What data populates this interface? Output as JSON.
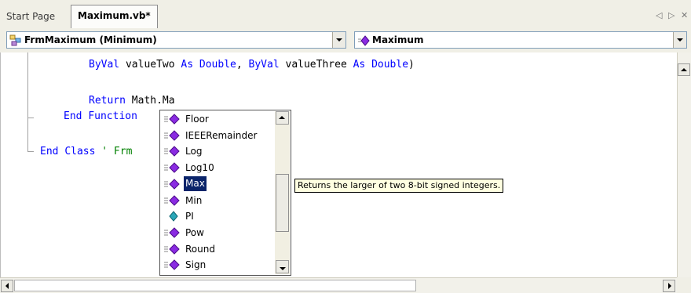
{
  "tabs": {
    "start_label": "Start Page",
    "active_label": "Maximum.vb*",
    "nav_prev": "◁",
    "nav_next": "▷",
    "close": "✕"
  },
  "combos": {
    "class_value": "FrmMaximum (Minimum)",
    "method_value": "Maximum",
    "class_icon": "class-icon",
    "method_icon": "method-icon"
  },
  "code": {
    "line1_indent": "        ",
    "line1_kw1": "ByVal",
    "line1_t1": " valueTwo ",
    "line1_kw2": "As",
    "line1_kw3": "Double",
    "line1_t2": ", ",
    "line1_kw4": "ByVal",
    "line1_t3": " valueThree ",
    "line1_kw5": "As",
    "line1_kw6": "Double",
    "line1_t4": ")",
    "line2_kw": "Return",
    "line2_text": " Math.Ma",
    "line3_kw1": "End",
    "line3_kw2": "Function",
    "line4_kw1": "End",
    "line4_kw2": "Class",
    "line4_comment": "' Frm"
  },
  "intellisense": {
    "items": [
      {
        "label": "Floor",
        "icon": "method-icon"
      },
      {
        "label": "IEEERemainder",
        "icon": "method-icon"
      },
      {
        "label": "Log",
        "icon": "method-icon"
      },
      {
        "label": "Log10",
        "icon": "method-icon"
      },
      {
        "label": "Max",
        "icon": "method-icon"
      },
      {
        "label": "Min",
        "icon": "method-icon"
      },
      {
        "label": "PI",
        "icon": "constant-icon"
      },
      {
        "label": "Pow",
        "icon": "method-icon"
      },
      {
        "label": "Round",
        "icon": "method-icon"
      },
      {
        "label": "Sign",
        "icon": "method-icon"
      }
    ],
    "selected": "Max"
  },
  "tooltip": {
    "text": "Returns the larger of two 8-bit signed integers."
  },
  "colors": {
    "keyword": "#0000ff",
    "comment": "#008000",
    "selection": "#0a246a",
    "tooltip_bg": "#ffffe1"
  }
}
